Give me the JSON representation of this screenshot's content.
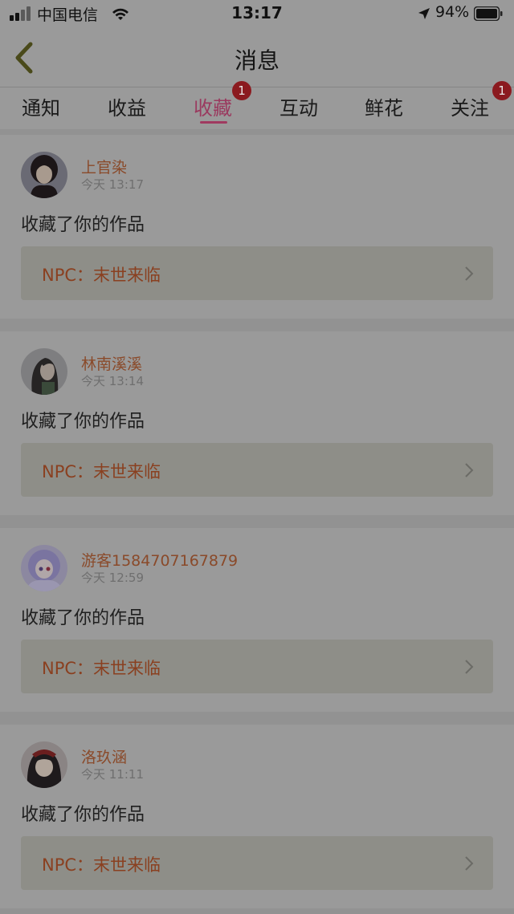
{
  "status_bar": {
    "carrier": "中国电信",
    "time": "13:17",
    "battery": "94%"
  },
  "nav": {
    "title": "消息"
  },
  "tabs": [
    {
      "label": "通知",
      "badge": ""
    },
    {
      "label": "收益",
      "badge": ""
    },
    {
      "label": "收藏",
      "badge": "1",
      "active": true
    },
    {
      "label": "互动",
      "badge": ""
    },
    {
      "label": "鲜花",
      "badge": ""
    },
    {
      "label": "关注",
      "badge": "1"
    }
  ],
  "messages": [
    {
      "username": "上官染",
      "time": "今天 13:17",
      "text": "收藏了你的作品",
      "work": "NPC：末世来临"
    },
    {
      "username": "林南溪溪",
      "time": "今天 13:14",
      "text": "收藏了你的作品",
      "work": "NPC：末世来临"
    },
    {
      "username": "游客1584707167879",
      "time": "今天 12:59",
      "text": "收藏了你的作品",
      "work": "NPC：末世来临"
    },
    {
      "username": "洛玖涵",
      "time": "今天 11:11",
      "text": "收藏了你的作品",
      "work": "NPC：末世来临"
    }
  ],
  "colors": {
    "accent": "#9a3a5f",
    "badge": "#8b1a1f",
    "username": "#8a4a2a"
  },
  "icons": {
    "back": "chevron-left-icon",
    "work_link": "chevron-right-icon"
  }
}
